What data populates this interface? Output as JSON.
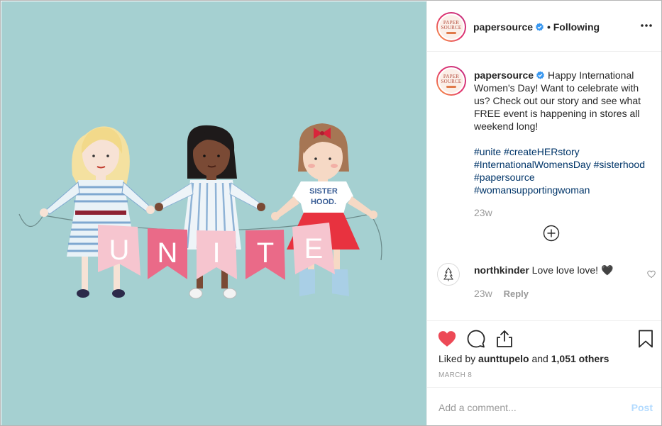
{
  "post": {
    "image_banner_letters": [
      "U",
      "N",
      "I",
      "T",
      "E"
    ],
    "shirt_text_line1": "SISTER",
    "shirt_text_line2": "HOOD."
  },
  "header": {
    "username": "papersource",
    "separator": "•",
    "follow_status": "Following",
    "avatar_logo_line1": "PAPER",
    "avatar_logo_line2": "SOURCE"
  },
  "caption": {
    "username": "papersource",
    "text": "Happy International Women's Day! Want to celebrate with us? Check out our story and see what FREE event is happening in stores all weekend long!",
    "hashtags": [
      "#unite",
      "#createHERstory",
      "#InternationalWomensDay",
      "#sisterhood",
      "#papersource",
      "#womansupportingwoman"
    ],
    "timestamp": "23w"
  },
  "comments": [
    {
      "username": "northkinder",
      "text": "Love love love! 🖤",
      "timestamp": "23w",
      "reply_label": "Reply"
    }
  ],
  "actions": {
    "likes_prefix": "Liked by",
    "liked_by_user": "aunttupelo",
    "likes_joiner": "and",
    "others_count": "1,051 others",
    "date": "MARCH 8"
  },
  "add_comment": {
    "placeholder": "Add a comment...",
    "post_label": "Post"
  },
  "colors": {
    "media_background": "#a5d0d1",
    "like_red": "#ed4956",
    "hashtag_blue": "#003569",
    "verified_blue": "#3897f0",
    "post_disabled": "#b3dbff"
  },
  "icons": [
    "verified-icon",
    "more-options-icon",
    "plus-circle-icon",
    "tree-icon",
    "heart-icon",
    "comment-icon",
    "share-icon",
    "bookmark-icon"
  ]
}
